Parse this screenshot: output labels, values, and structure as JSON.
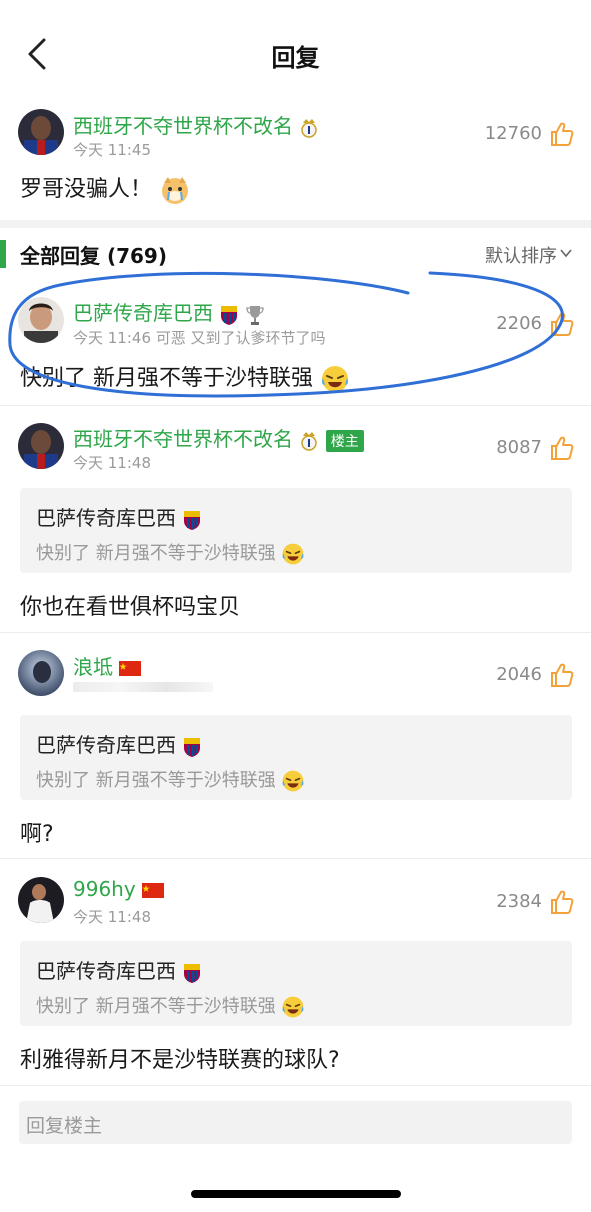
{
  "nav": {
    "title": "回复"
  },
  "op": {
    "username": "西班牙不夺世界杯不改名",
    "time": "今天 11:45",
    "likes": "12760",
    "text": "罗哥没骗人！"
  },
  "section": {
    "label": "全部回复 (769)",
    "sort": "默认排序"
  },
  "replies": [
    {
      "username": "巴萨传奇库巴西",
      "time": "今天 11:46 可恶 又到了认爹环节了吗",
      "likes": "2206",
      "text": "快别了 新月强不等于沙特联强"
    },
    {
      "username": "西班牙不夺世界杯不改名",
      "tag": "楼主",
      "time": "今天 11:48",
      "likes": "8087",
      "quote_user": "巴萨传奇库巴西",
      "quote_text": "快别了 新月强不等于沙特联强",
      "text": "你也在看世俱杯吗宝贝"
    },
    {
      "username": "浪坻",
      "likes": "2046",
      "quote_user": "巴萨传奇库巴西",
      "quote_text": "快别了 新月强不等于沙特联强",
      "text": "啊?"
    },
    {
      "username": "996hy",
      "time": "今天 11:48",
      "likes": "2384",
      "quote_user": "巴萨传奇库巴西",
      "quote_text": "快别了 新月强不等于沙特联强",
      "text": "利雅得新月不是沙特联赛的球队?"
    }
  ],
  "reply_input": {
    "placeholder": "回复楼主"
  },
  "colors": {
    "accent_green": "#2fa64a",
    "circle_blue": "#2f6fd6",
    "thumb_orange": "#f3a23a"
  },
  "icons": [
    "back-arrow-icon",
    "thumb-up-icon",
    "real-madrid-crest-icon",
    "barcelona-crest-icon",
    "trophy-icon",
    "china-flag-icon",
    "crying-doge-emoji-icon",
    "laughing-crying-emoji-icon",
    "chevron-down-icon"
  ]
}
